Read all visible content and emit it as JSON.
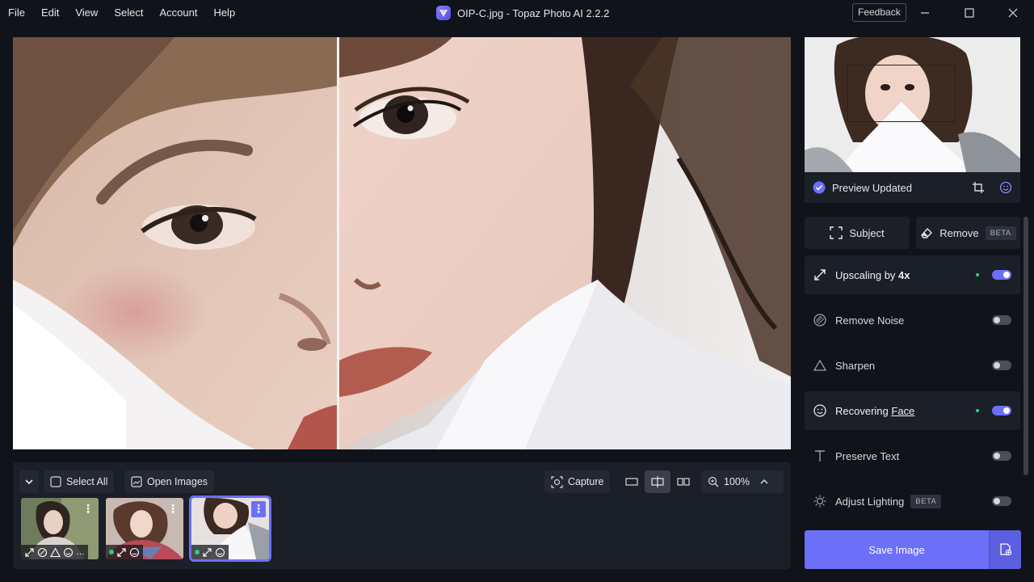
{
  "menu": [
    "File",
    "Edit",
    "View",
    "Select",
    "Account",
    "Help"
  ],
  "window": {
    "title": "OIP-C.jpg - Topaz Photo AI 2.2.2",
    "feedback": "Feedback"
  },
  "toolbar": {
    "select_all": "Select All",
    "open_images": "Open Images",
    "capture": "Capture",
    "zoom": "100%"
  },
  "preview": {
    "status": "Preview Updated"
  },
  "top_actions": {
    "subject": "Subject",
    "remove": "Remove",
    "remove_badge": "BETA"
  },
  "features": [
    {
      "label_prefix": "Upscaling by ",
      "label_bold": "4x",
      "enabled": true,
      "modified": true,
      "icon": "upscale-icon"
    },
    {
      "label": "Remove Noise",
      "enabled": false,
      "icon": "noise-icon"
    },
    {
      "label": "Sharpen",
      "enabled": false,
      "icon": "triangle-icon"
    },
    {
      "label_prefix": "Recovering ",
      "label_link": "Face",
      "enabled": true,
      "modified": true,
      "icon": "face-icon"
    },
    {
      "label": "Preserve Text",
      "enabled": false,
      "icon": "text-icon"
    },
    {
      "label": "Adjust Lighting",
      "badge": "BETA",
      "enabled": false,
      "icon": "sun-icon"
    }
  ],
  "save": {
    "label": "Save Image"
  },
  "colors": {
    "accent": "#6c6ff7",
    "background": "#10131a",
    "panel": "#1b1f28",
    "modified_dot": "#2ecf74"
  }
}
